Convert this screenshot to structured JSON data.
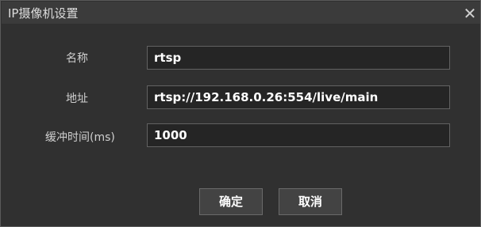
{
  "window": {
    "title": "IP摄像机设置",
    "close_glyph": "✕",
    "close_icon": "close-icon"
  },
  "form": {
    "name_label": "名称",
    "name_value": "rtsp",
    "address_label": "地址",
    "address_value": "rtsp://192.168.0.26:554/live/main",
    "buffer_label": "缓冲时间(ms)",
    "buffer_value": "1000"
  },
  "buttons": {
    "ok_label": "确定",
    "cancel_label": "取消"
  }
}
